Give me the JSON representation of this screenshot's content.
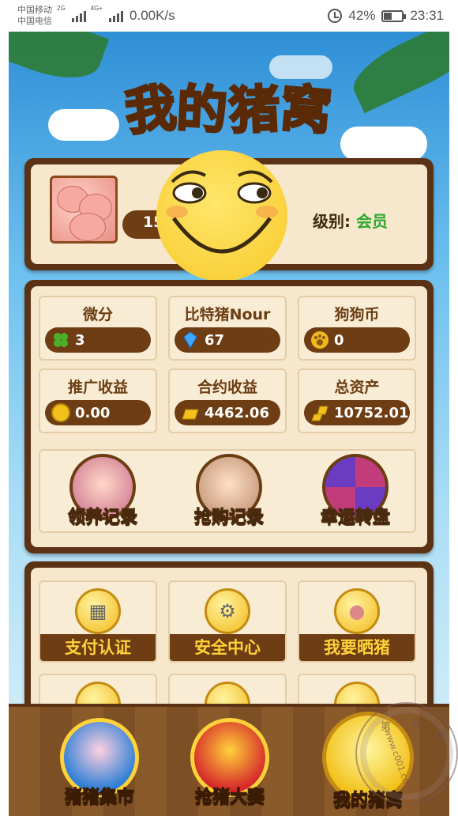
{
  "status_bar": {
    "carrier1": "中国移动",
    "carrier2": "中国电信",
    "net1": "2G",
    "net2": "4G+",
    "speed": "0.00K/s",
    "battery": "42%",
    "battery_level": 0.42,
    "time": "23:31"
  },
  "app": {
    "logo_chars": [
      "我",
      "的",
      "猪",
      "窝"
    ]
  },
  "profile": {
    "id_prefix": "15",
    "level_label": "级别:",
    "level_value": "会员"
  },
  "stats": [
    {
      "title": "微分",
      "value": "3",
      "icon": "clover-icon"
    },
    {
      "title": "比特猪Nour",
      "value": "67",
      "icon": "diamond-icon"
    },
    {
      "title": "狗狗币",
      "value": "0",
      "icon": "paw-icon"
    },
    {
      "title": "推广收益",
      "value": "0.00",
      "icon": "coin-icon"
    },
    {
      "title": "合约收益",
      "value": "4462.06",
      "icon": "gold-bar-icon"
    },
    {
      "title": "总资产",
      "value": "10752.01",
      "icon": "gold-bars-icon"
    }
  ],
  "actions": [
    {
      "label": "领养记录",
      "icon": "pig-nest-icon"
    },
    {
      "label": "抢购记录",
      "icon": "pig-scroll-icon"
    },
    {
      "label": "幸运转盘",
      "icon": "lucky-wheel-icon"
    }
  ],
  "tiles": [
    {
      "label": "支付认证",
      "icon": "cash-register-icon"
    },
    {
      "label": "安全中心",
      "icon": "gear-icon"
    },
    {
      "label": "我要晒猪",
      "icon": "pig-face-icon"
    }
  ],
  "nav": [
    {
      "label": "猪猪集市",
      "icon": "piggy-bank-icon"
    },
    {
      "label": "抢猪大赛",
      "icon": "trophy-icon"
    },
    {
      "label": "我的猪窝",
      "icon": "pig-home-icon"
    }
  ],
  "watermark": {
    "t1": "第",
    "t2": "私",
    "t3": "聚",
    "site": "www.c001.cn"
  }
}
